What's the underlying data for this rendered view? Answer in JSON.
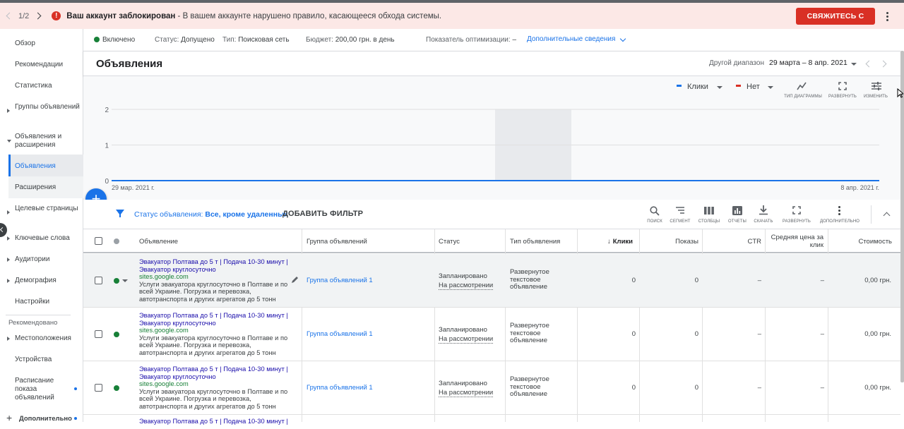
{
  "banner": {
    "pager": "1/2",
    "title": "Ваш аккаунт заблокирован",
    "message": " - В вашем аккаунте нарушено правило, касающееся обхода системы.",
    "contact_button": "СВЯЖИТЕСЬ С НАМИ",
    "color": "#fce8e6",
    "button_color": "#d93025"
  },
  "sidebar": {
    "items": [
      {
        "label": "Обзор"
      },
      {
        "label": "Рекомендации"
      },
      {
        "label": "Статистика"
      },
      {
        "label": "Группы объявлений"
      },
      {
        "label": "Объявления и расширения"
      },
      {
        "label": "Объявления"
      },
      {
        "label": "Расширения"
      },
      {
        "label": "Целевые страницы"
      },
      {
        "label": "Ключевые слова"
      },
      {
        "label": "Аудитории"
      },
      {
        "label": "Демография"
      },
      {
        "label": "Настройки"
      },
      {
        "label": "Рекомендовано"
      },
      {
        "label": "Местоположения"
      },
      {
        "label": "Устройства"
      },
      {
        "label": "Расписание показа объявлений"
      },
      {
        "label": "Дополнительно"
      }
    ]
  },
  "status": {
    "state": "Включено",
    "status_label": "Статус:",
    "status_value": "Допущено",
    "type_label": "Тип:",
    "type_value": "Поисковая сеть",
    "budget_label": "Бюджет:",
    "budget_value": "200,00 грн. в день",
    "opt_label": "Показатель оптимизации:",
    "opt_value": "–",
    "details_link": "Дополнительные сведения"
  },
  "header": {
    "title": "Объявления",
    "range_label": "Другой диапазон",
    "range_value": "29 марта – 8 апр. 2021"
  },
  "chart_toolbar": {
    "metric1": "Клики",
    "metric2": "Нет",
    "metric1_color": "#1a73e8",
    "metric2_color": "#d93025",
    "tools": [
      "ТИП ДИАГРАММЫ",
      "РАЗВЕРНУТЬ",
      "ИЗМЕНИТЬ"
    ]
  },
  "chart_data": {
    "type": "line",
    "x": [
      "29 мар. 2021 г.",
      "8 апр. 2021 г."
    ],
    "series": [
      {
        "name": "Клики",
        "values": [
          0,
          0,
          0,
          0,
          0,
          0,
          0,
          0,
          0,
          0,
          0
        ]
      }
    ],
    "yticks": [
      "2",
      "1",
      "0"
    ],
    "ylim": [
      0,
      2
    ],
    "grid": true,
    "xlabel_start": "29 мар. 2021 г.",
    "xlabel_end": "8 апр. 2021 г."
  },
  "filter": {
    "label": "Статус объявления:",
    "value": "Все, кроме удаленных",
    "add": "ДОБАВИТЬ ФИЛЬТР",
    "tools": [
      "ПОИСК",
      "СЕГМЕНТ",
      "СТОЛБЦЫ",
      "ОТЧЕТЫ",
      "СКАЧАТЬ",
      "РАЗВЕРНУТЬ",
      "ДОПОЛНИТЕЛЬНО"
    ]
  },
  "table": {
    "headers": [
      "Объявление",
      "Группа объявлений",
      "Статус",
      "Тип объявления",
      "Клики",
      "Показы",
      "CTR",
      "Средняя цена за клик",
      "Стоимость"
    ],
    "rows": [
      {
        "headline": "Эвакуатор Полтава до 5 т | Подача 10-30 минут | Эвакуатор круглосуточно",
        "url": "sites.google.com",
        "desc": "Услуги эвакуатора круглосуточно в Полтаве и по всей Украине. Погрузка и перевозка, автотранспорта и других агрегатов до 5 тонн",
        "group": "Группа объявлений 1",
        "status1": "Запланировано",
        "status2": "На рассмотрении",
        "type": "Развернутое текстовое объявление",
        "clicks": "0",
        "impr": "0",
        "ctr": "–",
        "cpc": "–",
        "cost": "0,00 грн."
      },
      {
        "headline": "Эвакуатор Полтава до 5 т | Подача 10-30 минут | Эвакуатор круглосуточно",
        "url": "sites.google.com",
        "desc": "Услуги эвакуатора круглосуточно в Полтаве и по всей Украине. Погрузка и перевозка, автотранспорта и других агрегатов до 5 тонн",
        "group": "Группа объявлений 1",
        "status1": "Запланировано",
        "status2": "На рассмотрении",
        "type": "Развернутое текстовое объявление",
        "clicks": "0",
        "impr": "0",
        "ctr": "–",
        "cpc": "–",
        "cost": "0,00 грн."
      },
      {
        "headline": "Эвакуатор Полтава до 5 т | Подача 10-30 минут | Эвакуатор круглосуточно",
        "url": "sites.google.com",
        "desc": "Услуги эвакуатора круглосуточно в Полтаве и по всей Украине. Погрузка и перевозка, автотранспорта и других агрегатов до 5 тонн",
        "group": "Группа объявлений 1",
        "status1": "Запланировано",
        "status2": "На рассмотрении",
        "type": "Развернутое текстовое объявление",
        "clicks": "0",
        "impr": "0",
        "ctr": "–",
        "cpc": "–",
        "cost": "0,00 грн."
      },
      {
        "headline": "Эвакуатор Полтава до 5 т | Подача 10-30 минут |"
      }
    ]
  }
}
